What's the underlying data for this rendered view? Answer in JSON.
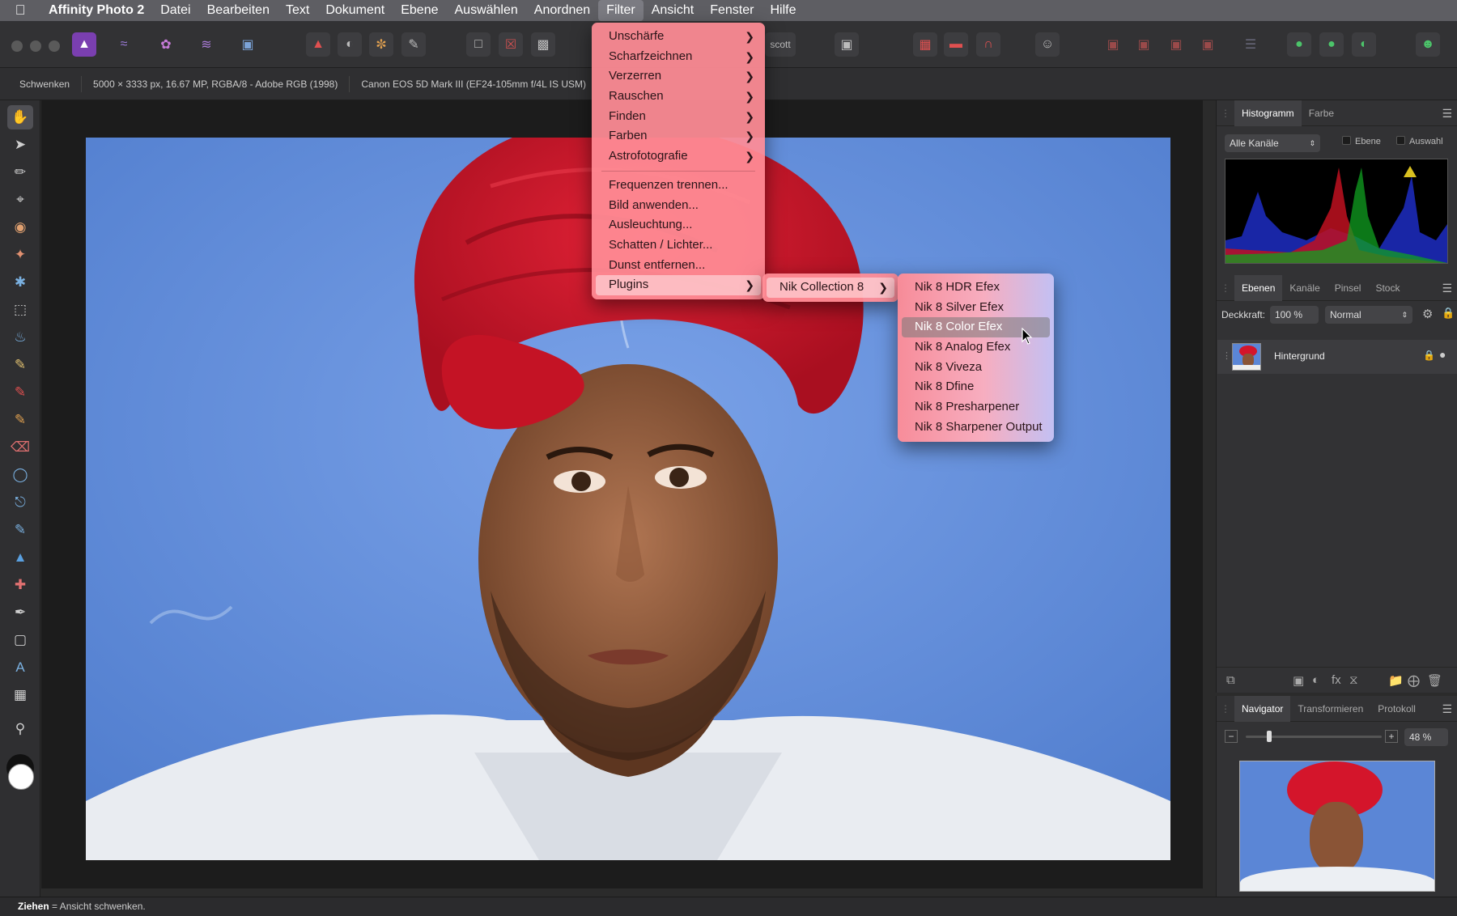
{
  "menubar": {
    "app": "Affinity Photo 2",
    "items": [
      "Datei",
      "Bearbeiten",
      "Text",
      "Dokument",
      "Ebene",
      "Auswählen",
      "Anordnen",
      "Filter",
      "Ansicht",
      "Fenster",
      "Hilfe"
    ]
  },
  "toolbar": {
    "partial_label": "scott"
  },
  "contextbar": {
    "tool": "Schwenken",
    "docinfo": "5000 × 3333 px, 16.67 MP, RGBA/8 - Adobe RGB (1998)",
    "camera": "Canon EOS 5D Mark III (EF24-105mm f/4L IS USM)"
  },
  "filter_menu": {
    "group1": [
      "Unschärfe",
      "Scharfzeichnen",
      "Verzerren",
      "Rauschen",
      "Finden",
      "Farben",
      "Astrofotografie"
    ],
    "group2": [
      "Frequenzen trennen...",
      "Bild anwenden...",
      "Ausleuchtung...",
      "Schatten / Lichter...",
      "Dunst entfernen..."
    ],
    "plugins": "Plugins"
  },
  "plugins_submenu": {
    "item": "Nik Collection 8"
  },
  "nik_submenu": {
    "items": [
      "Nik 8 HDR Efex",
      "Nik 8 Silver Efex",
      "Nik 8 Color Efex",
      "Nik 8 Analog Efex",
      "Nik 8 Viveza",
      "Nik 8 Dfine",
      "Nik 8 Presharpener",
      "Nik 8 Sharpener Output"
    ],
    "hovered": "Nik 8 Color Efex"
  },
  "histogram_panel": {
    "tabs": [
      "Histogramm",
      "Farbe"
    ],
    "channel": "Alle Kanäle",
    "opt_layer": "Ebene",
    "opt_selection": "Auswahl"
  },
  "layers_panel": {
    "tabs": [
      "Ebenen",
      "Kanäle",
      "Pinsel",
      "Stock"
    ],
    "opacity_label": "Deckkraft:",
    "opacity_value": "100 %",
    "blend_mode": "Normal",
    "layer_name": "Hintergrund"
  },
  "navigator_panel": {
    "tabs": [
      "Navigator",
      "Transformieren",
      "Protokoll"
    ],
    "zoom": "48 %"
  },
  "statusbar": {
    "action": "Ziehen",
    "text": " = Ansicht schwenken."
  },
  "colors": {
    "menu_pink": "#ff8c96",
    "accent_purple": "#7a3fb0",
    "turban_red": "#d4152b",
    "wall_blue": "#5b86d6"
  }
}
